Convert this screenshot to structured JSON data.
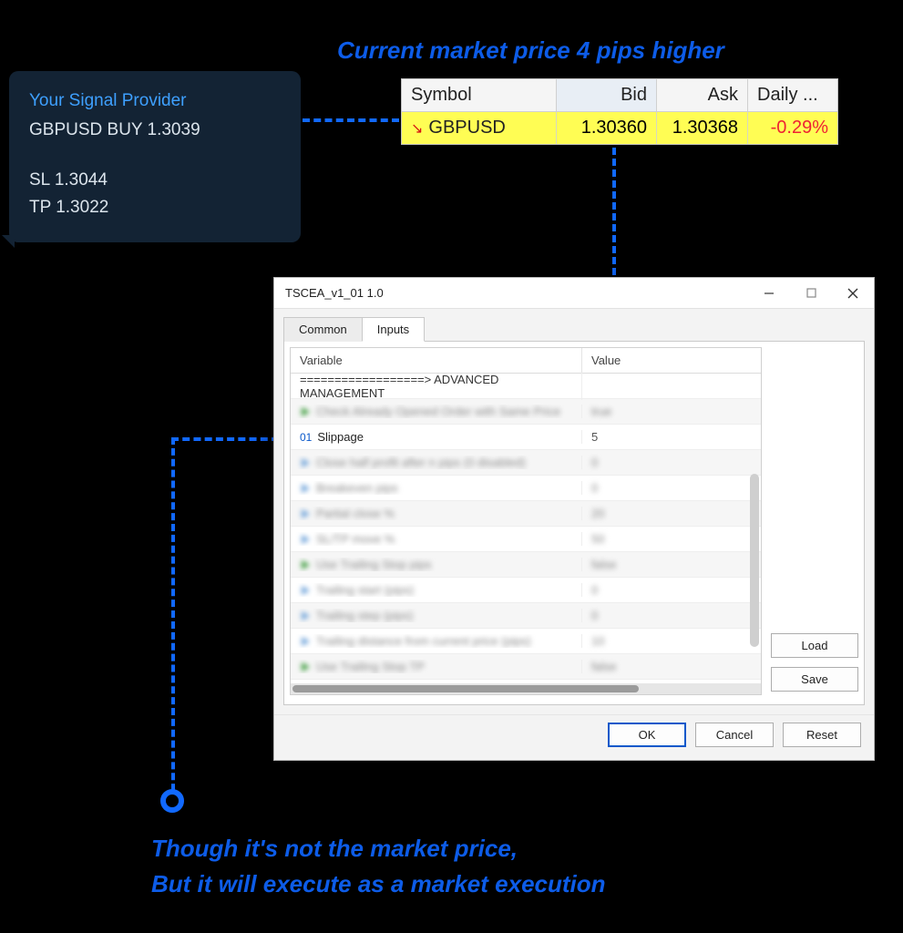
{
  "annotations": {
    "top": "Current market price 4 pips higher",
    "bottom_line1": "Though it's not  the market price,",
    "bottom_line2": "But it will execute as a market execution"
  },
  "signal": {
    "title": "Your Signal Provider",
    "order": "GBPUSD BUY 1.3039",
    "sl": "SL 1.3044",
    "tp": "TP 1.3022"
  },
  "price_table": {
    "headers": {
      "c1": "Symbol",
      "c2": "Bid",
      "c3": "Ask",
      "c4": "Daily ..."
    },
    "row": {
      "symbol": "GBPUSD",
      "bid": "1.30360",
      "ask": "1.30368",
      "daily": "-0.29%"
    }
  },
  "dialog": {
    "title": "TSCEA_v1_01 1.0",
    "tabs": {
      "common": "Common",
      "inputs": "Inputs"
    },
    "grid_headers": {
      "variable": "Variable",
      "value": "Value"
    },
    "section": "==================> ADVANCED MANAGEMENT",
    "slippage_idx": "01",
    "slippage_label": "Slippage",
    "slippage_value": "5",
    "buttons": {
      "load": "Load",
      "save": "Save",
      "ok": "OK",
      "cancel": "Cancel",
      "reset": "Reset"
    }
  }
}
